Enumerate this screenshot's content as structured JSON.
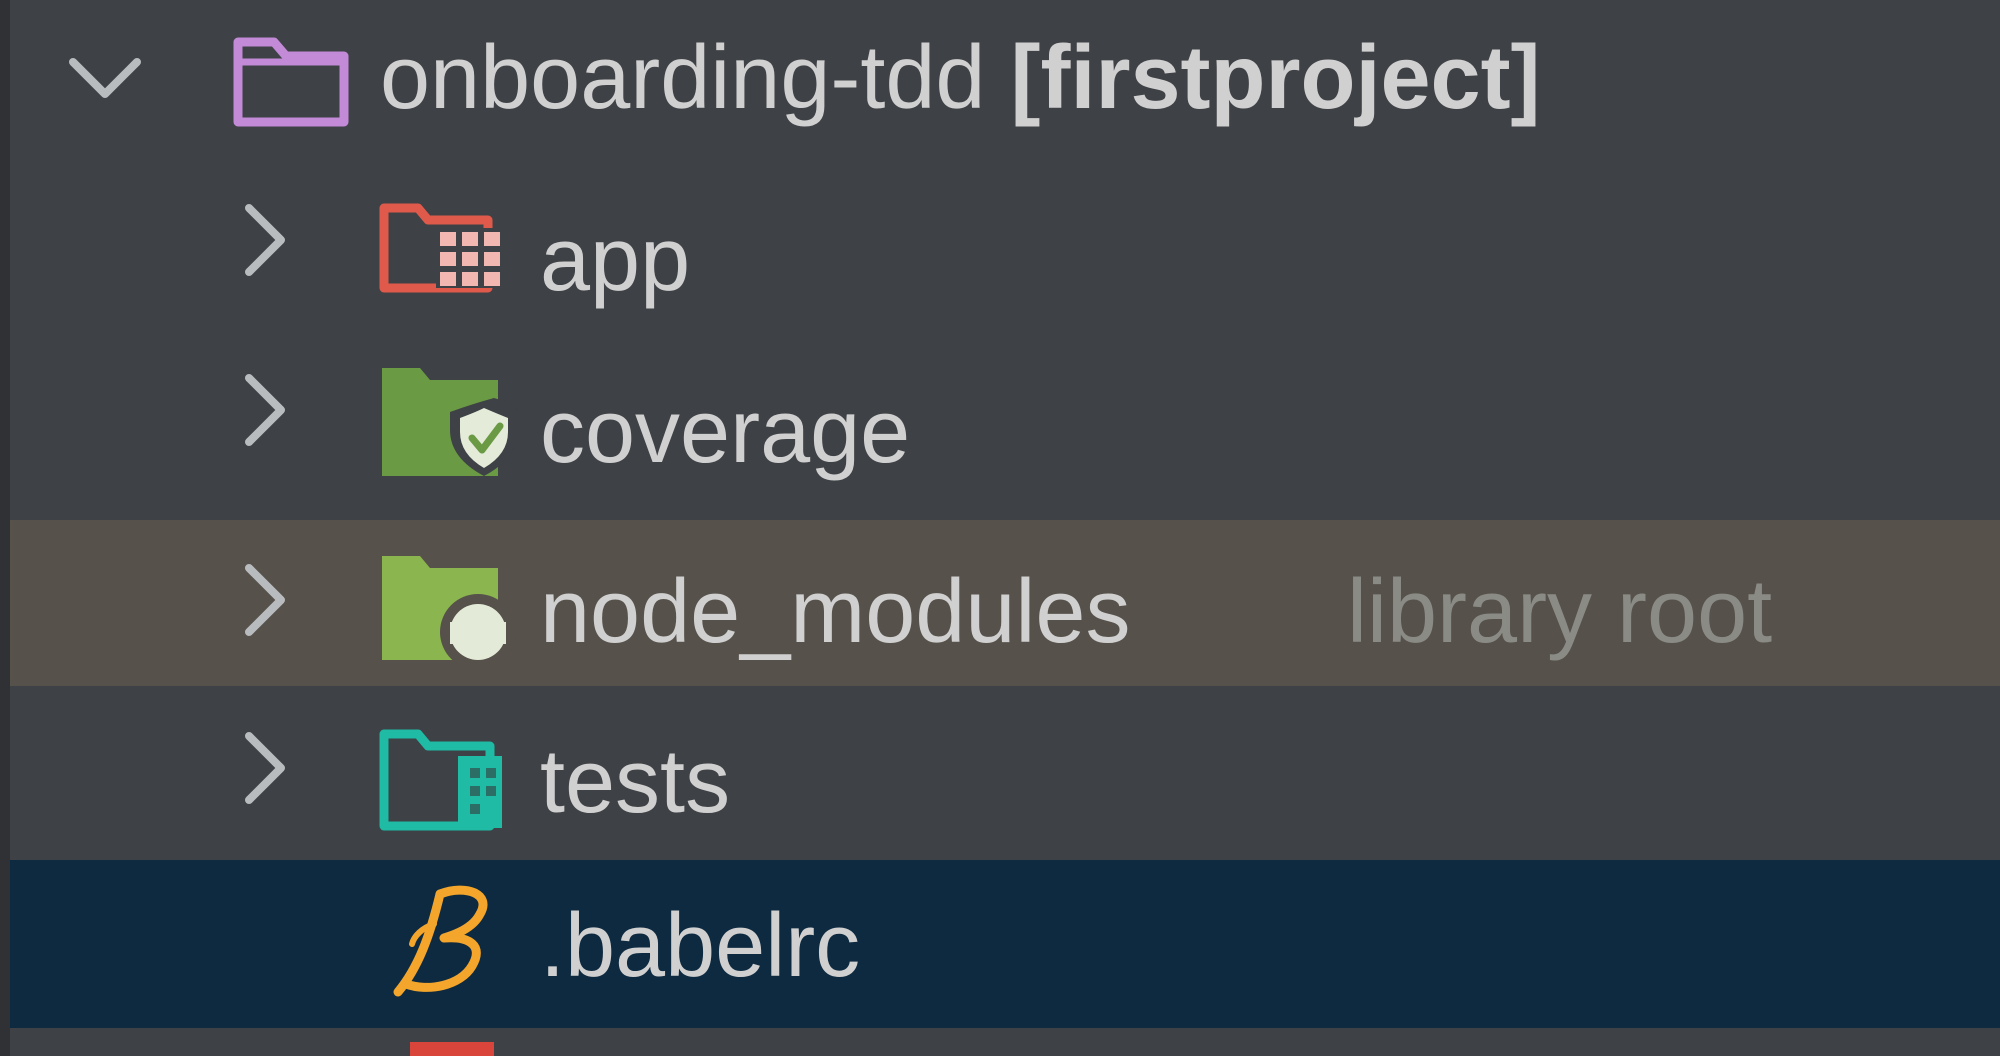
{
  "project_tree": {
    "root": {
      "name": "onboarding-tdd",
      "module": "[firstproject]",
      "expanded": true,
      "icon": "folder-icon"
    },
    "items": [
      {
        "label": "app",
        "icon": "app-folder-icon",
        "expanded": false
      },
      {
        "label": "coverage",
        "icon": "coverage-folder-icon",
        "expanded": false
      },
      {
        "label": "node_modules",
        "hint": "library root",
        "icon": "library-folder-icon",
        "expanded": false,
        "highlighted": true
      },
      {
        "label": "tests",
        "icon": "tests-folder-icon",
        "expanded": false
      },
      {
        "label": ".babelrc",
        "icon": "babel-icon",
        "selected": true
      }
    ]
  },
  "colors": {
    "background": "#3e4145",
    "highlight_row": "#56514a",
    "selected_row": "#0e2a40",
    "text": "#d0d0d0",
    "hint_text": "#8b8b86"
  }
}
